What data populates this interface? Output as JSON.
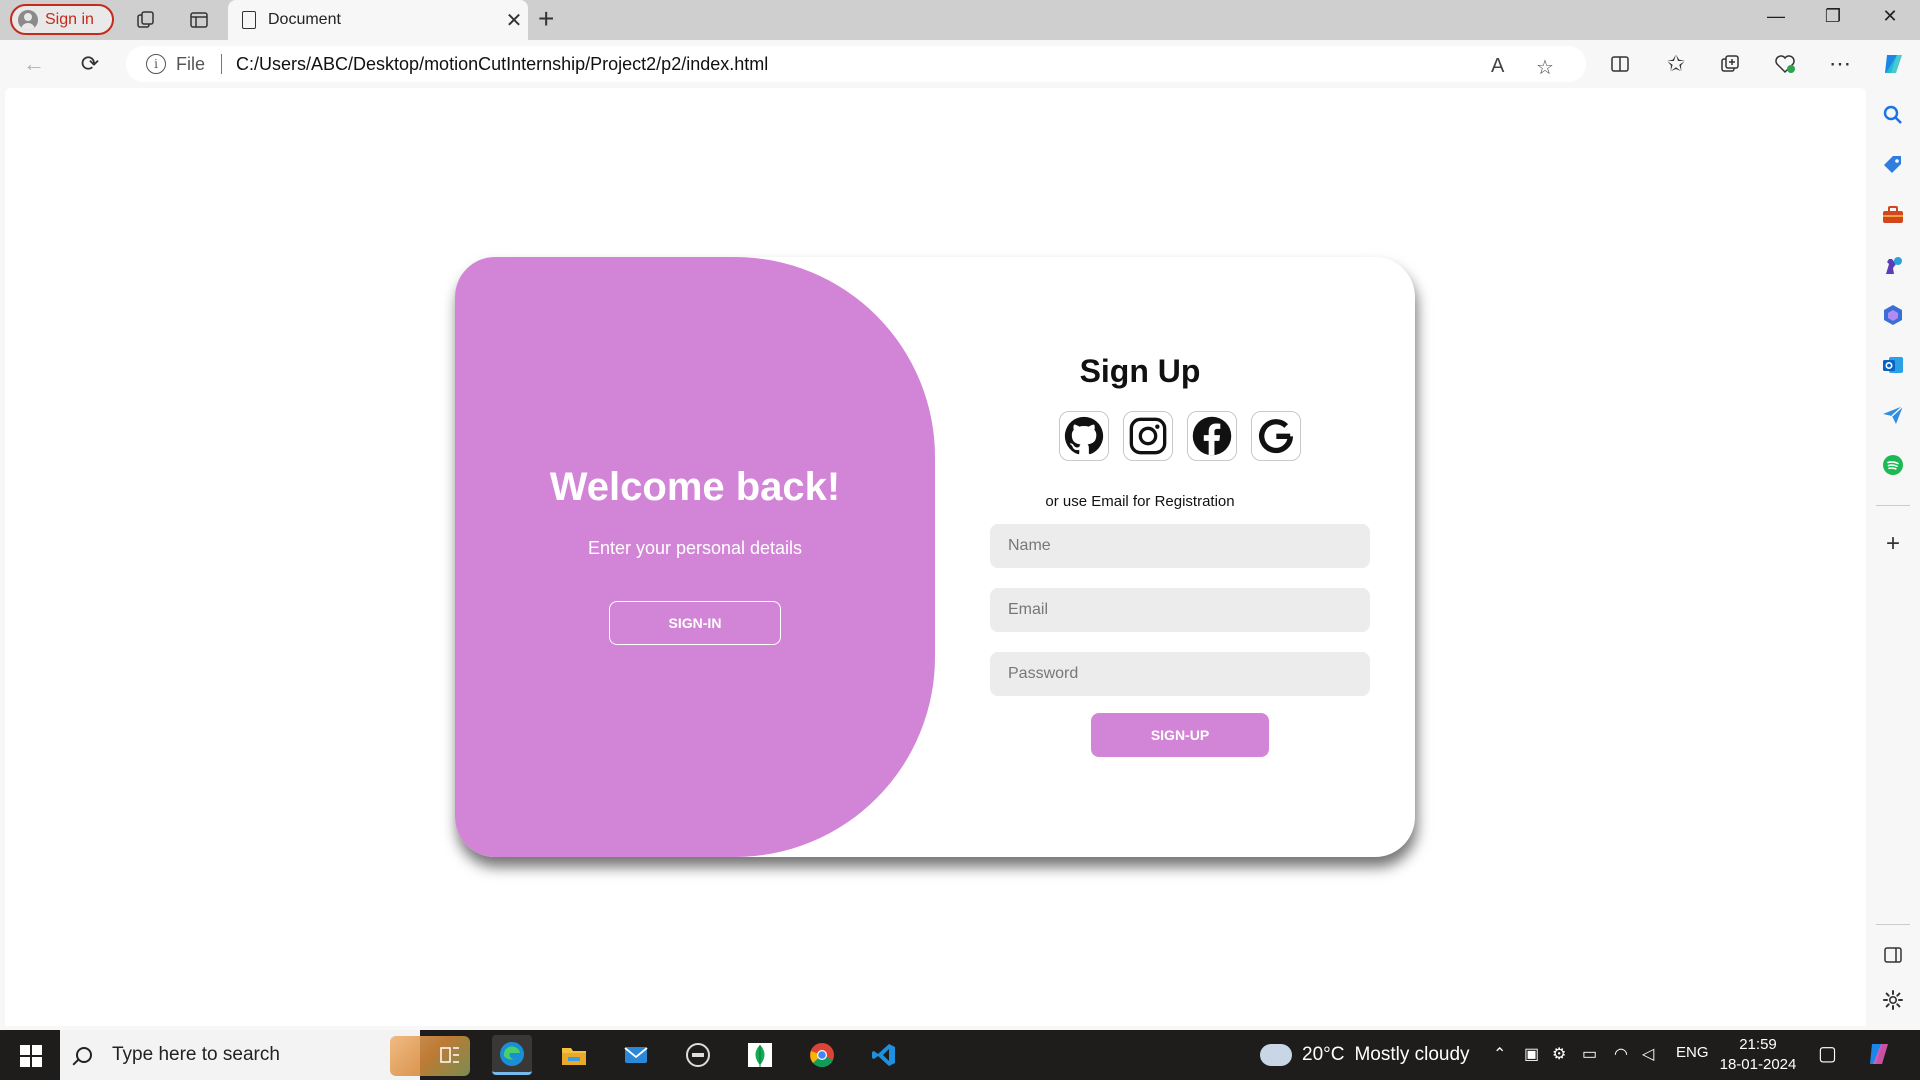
{
  "browser": {
    "profile_label": "Sign in",
    "tab_title": "Document",
    "address_scheme_label": "File",
    "url": "C:/Users/ABC/Desktop/motionCutInternship/Project2/p2/index.html"
  },
  "page": {
    "welcome": {
      "title": "Welcome back!",
      "subtitle": "Enter your personal details",
      "signin_button": "SIGN-IN"
    },
    "signup": {
      "title": "Sign Up",
      "social_icons": [
        "github-icon",
        "instagram-icon",
        "facebook-icon",
        "google-icon"
      ],
      "divider_text": "or use Email for Registration",
      "name_placeholder": "Name",
      "email_placeholder": "Email",
      "password_placeholder": "Password",
      "submit_button": "SIGN-UP"
    },
    "colors": {
      "accent": "#d285d6",
      "field_bg": "#ececec"
    }
  },
  "taskbar": {
    "search_placeholder": "Type here to search",
    "weather_temp": "20°C",
    "weather_desc": "Mostly cloudy",
    "language": "ENG",
    "time": "21:59",
    "date": "18-01-2024"
  }
}
